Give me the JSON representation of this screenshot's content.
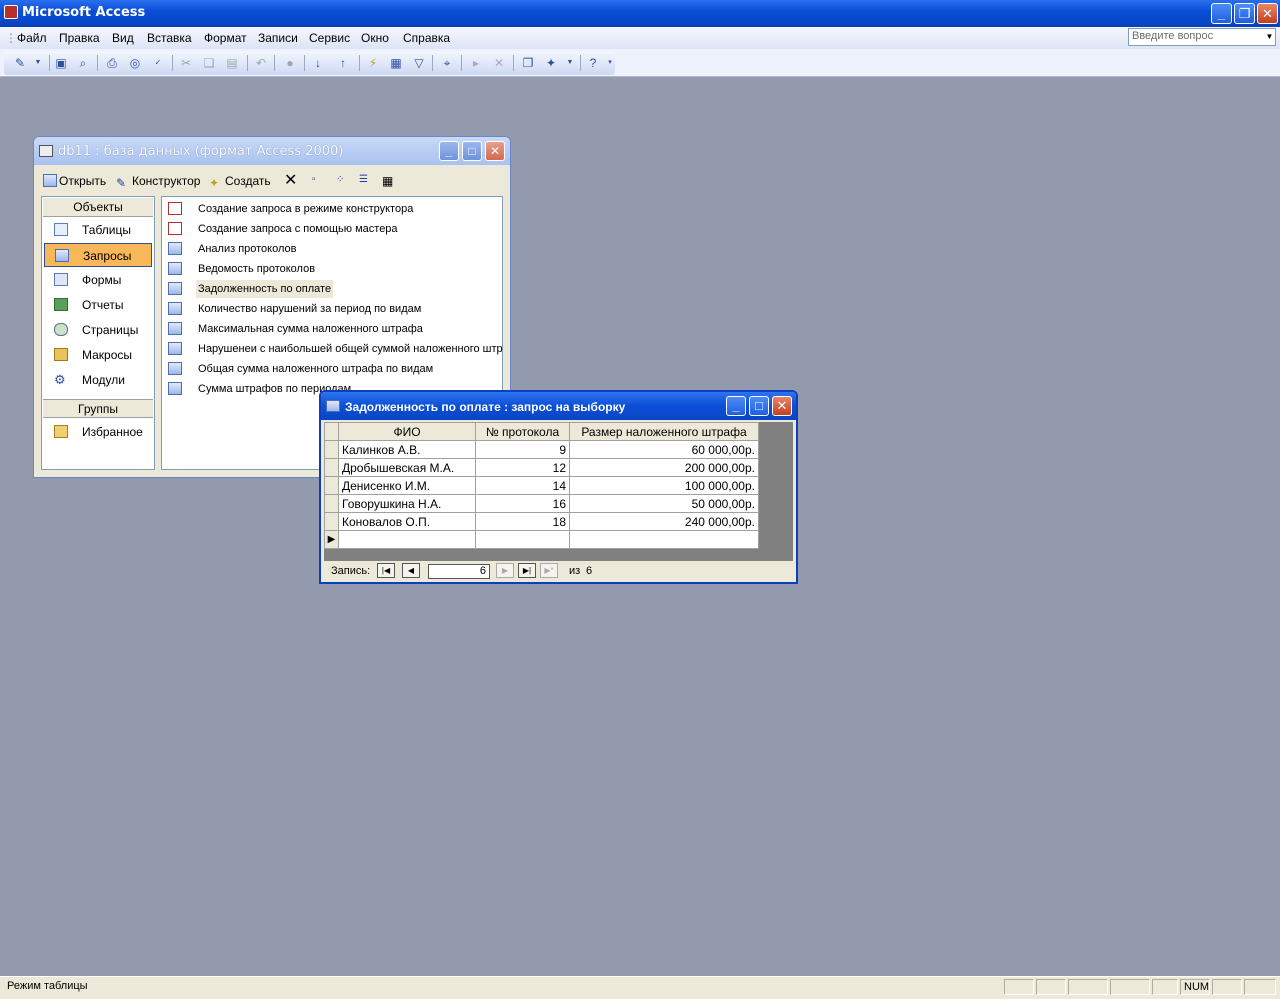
{
  "app": {
    "title": "Microsoft Access"
  },
  "menu": {
    "items": [
      "Файл",
      "Правка",
      "Вид",
      "Вставка",
      "Формат",
      "Записи",
      "Сервис",
      "Окно",
      "Справка"
    ],
    "ask_placeholder": "Введите вопрос"
  },
  "db_window": {
    "title": "db11 : база данных (формат Access 2000)",
    "toolbar": {
      "open": "Открыть",
      "design": "Конструктор",
      "create": "Создать"
    },
    "objects_header": "Объекты",
    "objects": [
      "Таблицы",
      "Запросы",
      "Формы",
      "Отчеты",
      "Страницы",
      "Макросы",
      "Модули"
    ],
    "selected_object": "Запросы",
    "groups_header": "Группы",
    "groups": [
      "Избранное"
    ],
    "list": [
      "Создание запроса в режиме конструктора",
      "Создание запроса с помощью мастера",
      "Анализ протоколов",
      "Ведомость протоколов",
      "Задолженность по оплате",
      "Количество нарушений за период по видам",
      "Максимальная сумма наложенного штрафа",
      "Нарушенеи с наибольшей общей суммой наложенного штрафа",
      "Общая сумма наложенного штрафа по видам",
      "Сумма штрафов по периодам"
    ]
  },
  "query_window": {
    "title": "Задолженность по оплате : запрос на выборку",
    "columns": [
      "ФИО",
      "№ протокола",
      "Размер наложенного штрафа"
    ],
    "rows": [
      [
        "Калинков А.В.",
        "9",
        "60 000,00р."
      ],
      [
        "Дробышевская М.А.",
        "12",
        "200 000,00р."
      ],
      [
        "Денисенко И.М.",
        "14",
        "100 000,00р."
      ],
      [
        "Говорушкина Н.А.",
        "16",
        "50 000,00р."
      ],
      [
        "Коновалов О.П.",
        "18",
        "240 000,00р."
      ]
    ],
    "nav": {
      "label": "Запись:",
      "current": "6",
      "of_label": "из",
      "total": "6"
    }
  },
  "status": {
    "mode": "Режим таблицы",
    "num": "NUM"
  }
}
